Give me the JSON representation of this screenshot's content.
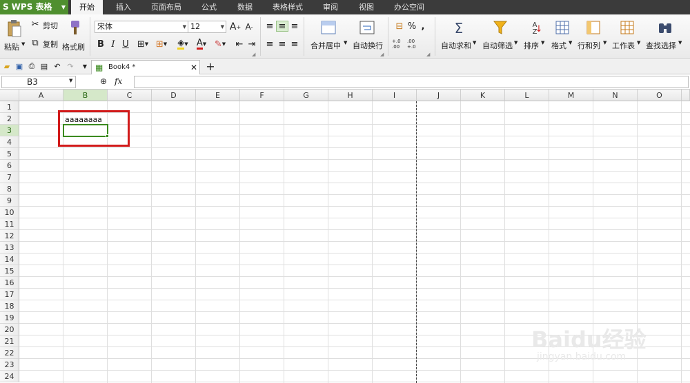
{
  "app": {
    "logo_mark": "S",
    "name": "WPS 表格",
    "logo_menu_icon": "triangle-down-icon"
  },
  "menu_tabs": [
    "开始",
    "插入",
    "页面布局",
    "公式",
    "数据",
    "表格样式",
    "审阅",
    "视图",
    "办公空间"
  ],
  "active_tab": "开始",
  "ribbon": {
    "paste": "粘贴",
    "cut": "剪切",
    "copy": "复制",
    "format_painter": "格式刷",
    "font_name": "宋体",
    "font_size": "12",
    "bold": "B",
    "italic": "I",
    "underline": "U",
    "merge_center": "合并居中",
    "wrap_text": "自动换行",
    "percent": "%",
    "comma": ",",
    "inc_decimal": "+.0 .00",
    "dec_decimal": ".00 +.0",
    "autosum": "自动求和",
    "autofilter": "自动筛选",
    "sort": "排序",
    "format": "格式",
    "rows_cols": "行和列",
    "worksheet": "工作表",
    "find_select": "查找选择"
  },
  "document_tab": {
    "title": "Book4 *"
  },
  "formula_bar": {
    "name_box": "B3",
    "fx": "fx",
    "content": ""
  },
  "columns": [
    "A",
    "B",
    "C",
    "D",
    "E",
    "F",
    "G",
    "H",
    "I",
    "J",
    "K",
    "L",
    "M",
    "N",
    "O"
  ],
  "rows": [
    "1",
    "2",
    "3",
    "4",
    "5",
    "6",
    "7",
    "8",
    "9",
    "10",
    "11",
    "12",
    "13",
    "14",
    "15",
    "16",
    "17",
    "18",
    "19",
    "20",
    "21",
    "22",
    "23",
    "24"
  ],
  "selected_column": "B",
  "selected_row": "3",
  "cells": {
    "B2": "aaaaaaaa"
  },
  "watermark": {
    "logo": "Baidu经验",
    "url": "jingyan.baidu.com"
  },
  "colors": {
    "accent_green": "#3b8a1f",
    "highlight_red": "#d11a1a",
    "menubar": "#3b3b3b"
  }
}
